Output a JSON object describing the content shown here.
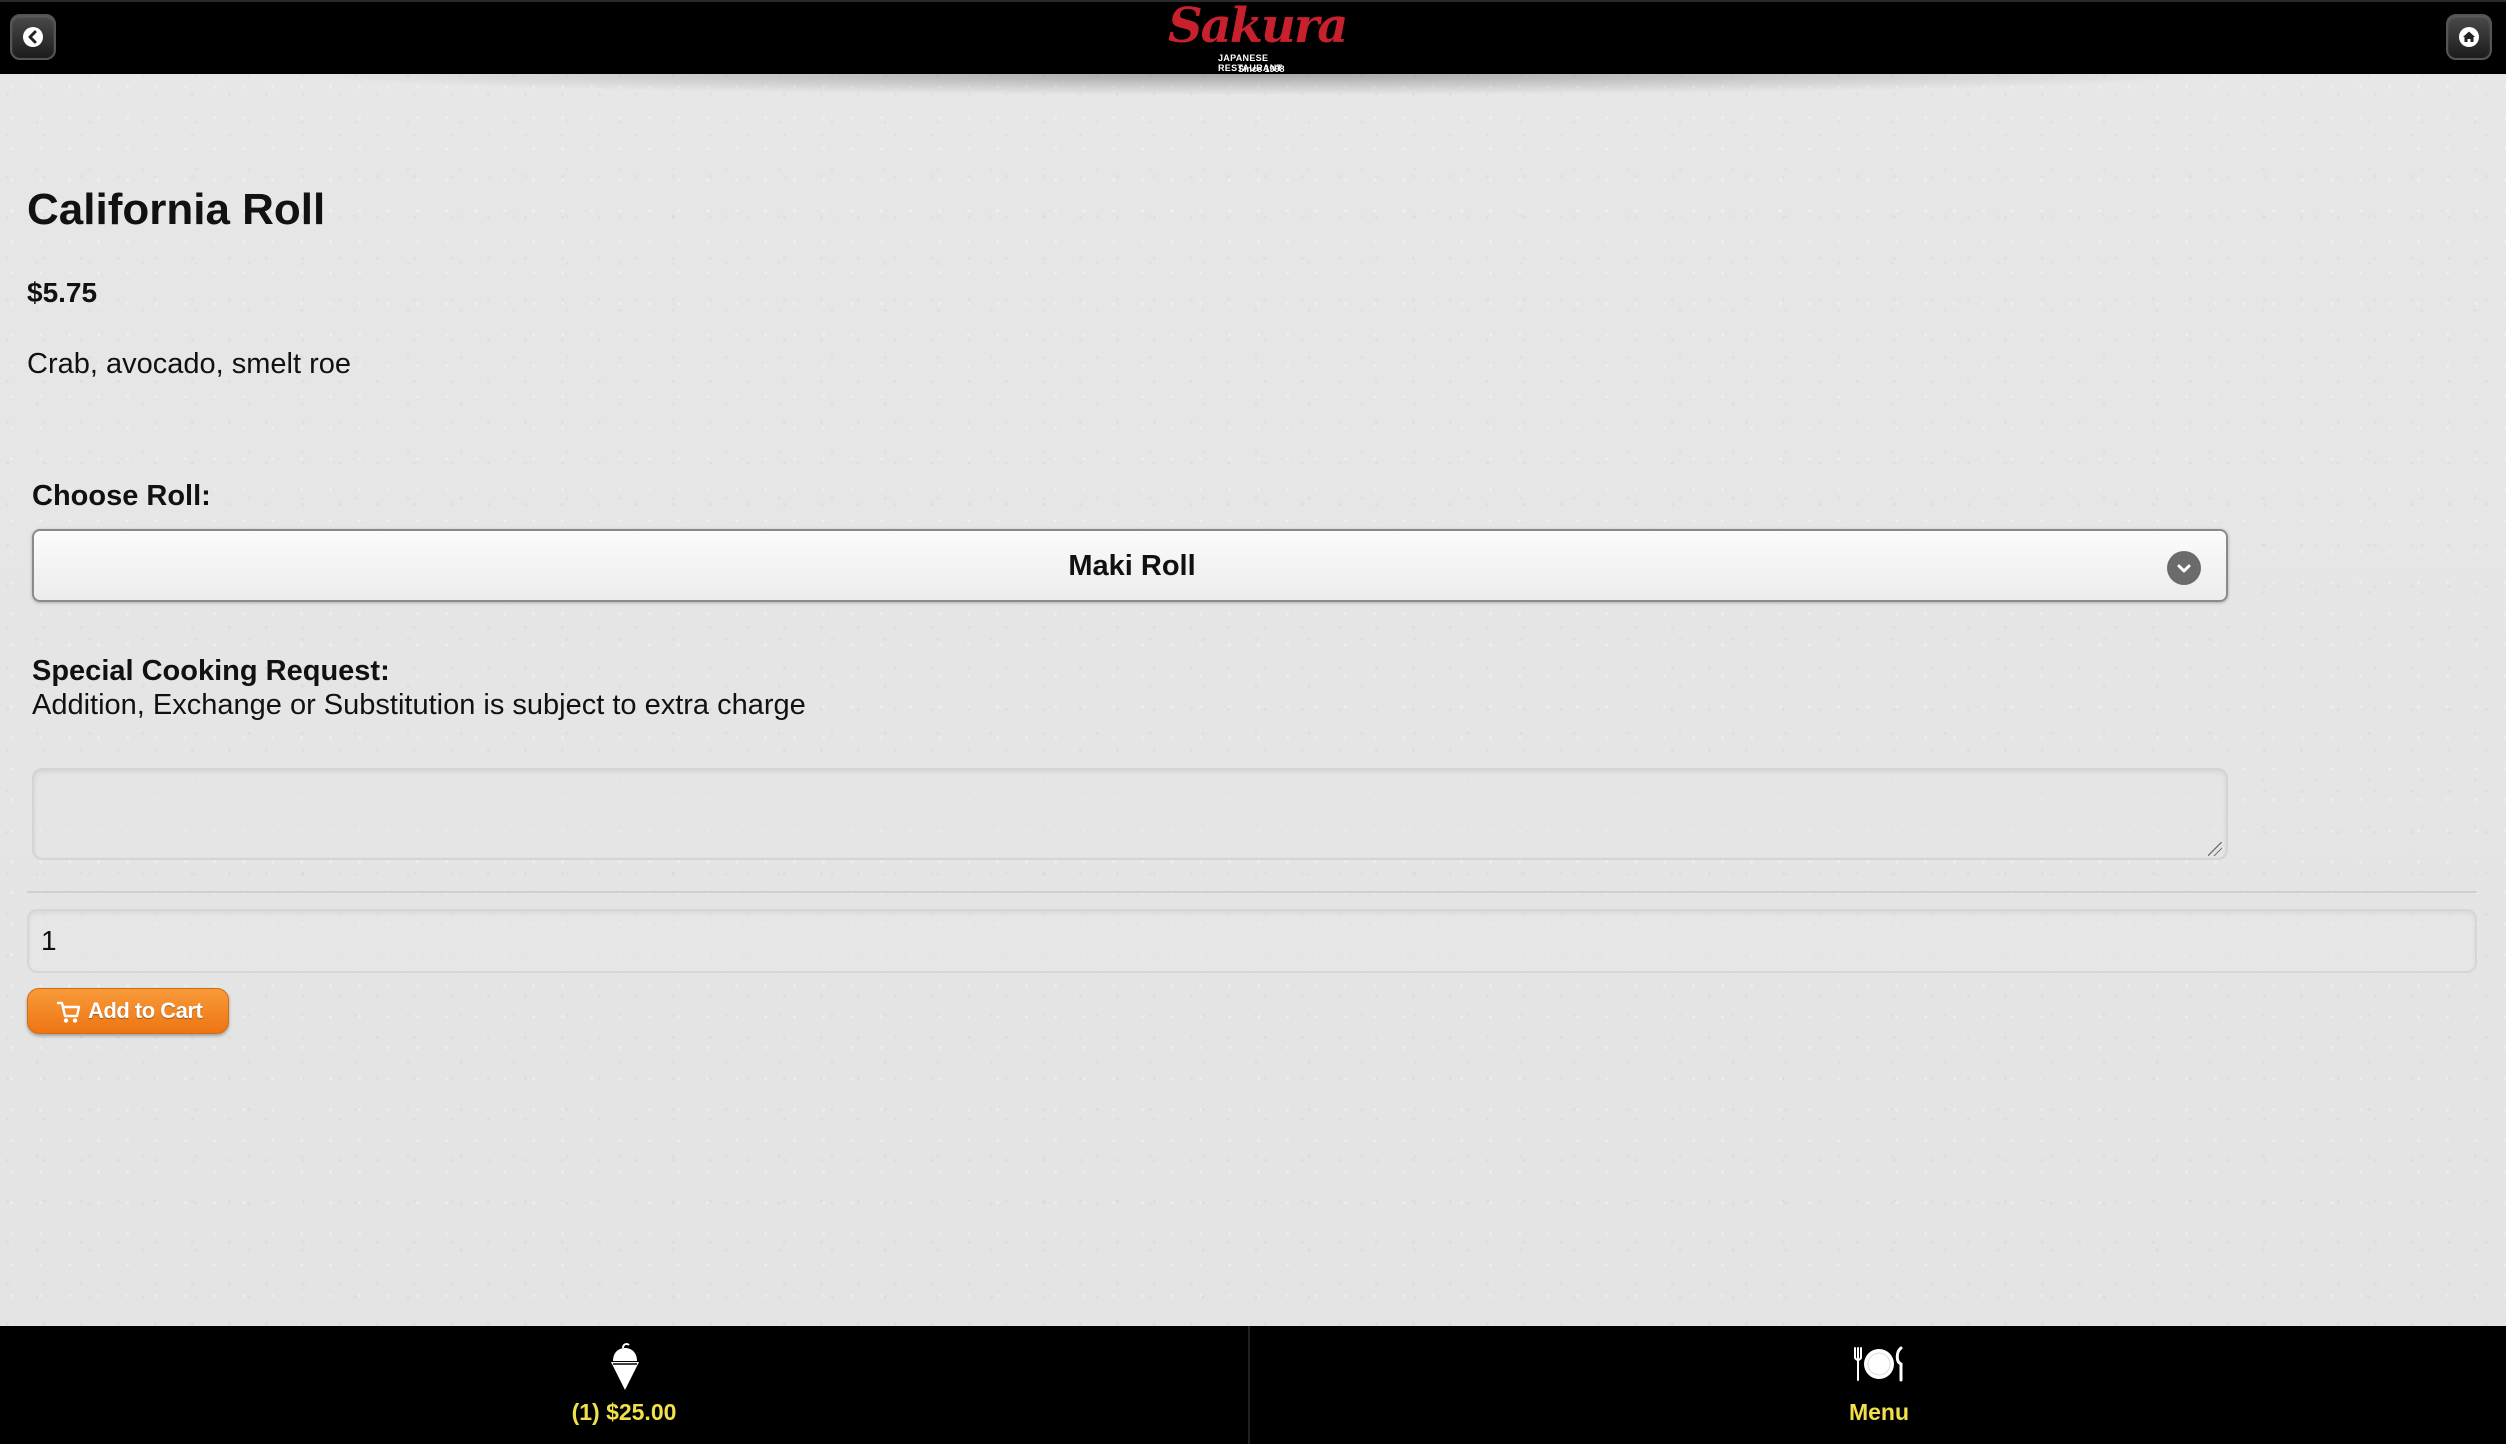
{
  "header": {
    "back_icon": "chevron-left-icon",
    "home_icon": "home-icon",
    "logo": {
      "script": "Sakura",
      "tagline": "JAPANESE RESTAURANT",
      "since": "Since 1998"
    }
  },
  "item": {
    "title": "California Roll",
    "price": "$5.75",
    "description": "Crab, avocado, smelt roe"
  },
  "options": {
    "roll_label": "Choose Roll:",
    "roll_selected": "Maki Roll"
  },
  "request": {
    "label": "Special Cooking Request:",
    "note": "Addition, Exchange or Substitution is subject to extra charge",
    "value": ""
  },
  "quantity": {
    "value": "1"
  },
  "cart_button": {
    "label": "Add to Cart",
    "icon": "cart-icon"
  },
  "footer": {
    "cart": {
      "label": "(1) $25.00",
      "icon": "ice-cream-icon"
    },
    "menu": {
      "label": "Menu",
      "icon": "plate-cutlery-icon"
    }
  },
  "colors": {
    "header_bg": "#000000",
    "accent_orange": "#f08020",
    "footer_label": "#f1e04a",
    "logo_red": "#c8202c"
  }
}
